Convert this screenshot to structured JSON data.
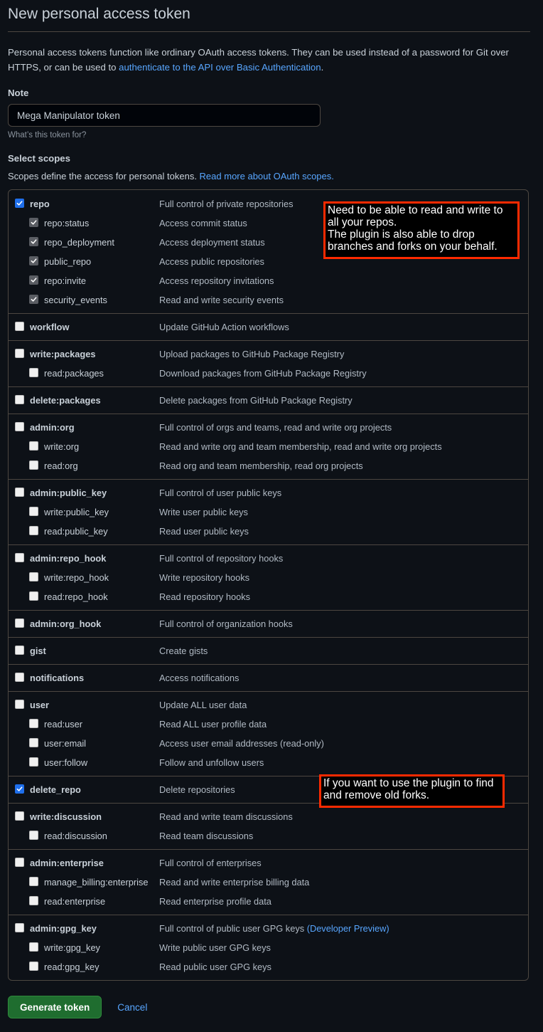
{
  "page": {
    "title": "New personal access token",
    "intro_text": "Personal access tokens function like ordinary OAuth access tokens. They can be used instead of a password for Git over HTTPS, or can be used to ",
    "intro_link": "authenticate to the API over Basic Authentication",
    "intro_suffix": "."
  },
  "note": {
    "label": "Note",
    "value": "Mega Manipulator token",
    "hint": "What’s this token for?"
  },
  "scopes": {
    "title": "Select scopes",
    "description": "Scopes define the access for personal tokens. ",
    "link": "Read more about OAuth scopes.",
    "groups": [
      {
        "name": "repo",
        "description": "Full control of private repositories",
        "checked": true,
        "children": [
          {
            "name": "repo:status",
            "description": "Access commit status",
            "checked": true
          },
          {
            "name": "repo_deployment",
            "description": "Access deployment status",
            "checked": true
          },
          {
            "name": "public_repo",
            "description": "Access public repositories",
            "checked": true
          },
          {
            "name": "repo:invite",
            "description": "Access repository invitations",
            "checked": true
          },
          {
            "name": "security_events",
            "description": "Read and write security events",
            "checked": true
          }
        ]
      },
      {
        "name": "workflow",
        "description": "Update GitHub Action workflows",
        "checked": false,
        "children": []
      },
      {
        "name": "write:packages",
        "description": "Upload packages to GitHub Package Registry",
        "checked": false,
        "children": [
          {
            "name": "read:packages",
            "description": "Download packages from GitHub Package Registry",
            "checked": false
          }
        ]
      },
      {
        "name": "delete:packages",
        "description": "Delete packages from GitHub Package Registry",
        "checked": false,
        "children": []
      },
      {
        "name": "admin:org",
        "description": "Full control of orgs and teams, read and write org projects",
        "checked": false,
        "children": [
          {
            "name": "write:org",
            "description": "Read and write org and team membership, read and write org projects",
            "checked": false
          },
          {
            "name": "read:org",
            "description": "Read org and team membership, read org projects",
            "checked": false
          }
        ]
      },
      {
        "name": "admin:public_key",
        "description": "Full control of user public keys",
        "checked": false,
        "children": [
          {
            "name": "write:public_key",
            "description": "Write user public keys",
            "checked": false
          },
          {
            "name": "read:public_key",
            "description": "Read user public keys",
            "checked": false
          }
        ]
      },
      {
        "name": "admin:repo_hook",
        "description": "Full control of repository hooks",
        "checked": false,
        "children": [
          {
            "name": "write:repo_hook",
            "description": "Write repository hooks",
            "checked": false
          },
          {
            "name": "read:repo_hook",
            "description": "Read repository hooks",
            "checked": false
          }
        ]
      },
      {
        "name": "admin:org_hook",
        "description": "Full control of organization hooks",
        "checked": false,
        "children": []
      },
      {
        "name": "gist",
        "description": "Create gists",
        "checked": false,
        "children": []
      },
      {
        "name": "notifications",
        "description": "Access notifications",
        "checked": false,
        "children": []
      },
      {
        "name": "user",
        "description": "Update ALL user data",
        "checked": false,
        "children": [
          {
            "name": "read:user",
            "description": "Read ALL user profile data",
            "checked": false
          },
          {
            "name": "user:email",
            "description": "Access user email addresses (read-only)",
            "checked": false
          },
          {
            "name": "user:follow",
            "description": "Follow and unfollow users",
            "checked": false
          }
        ]
      },
      {
        "name": "delete_repo",
        "description": "Delete repositories",
        "checked": true,
        "children": []
      },
      {
        "name": "write:discussion",
        "description": "Read and write team discussions",
        "checked": false,
        "children": [
          {
            "name": "read:discussion",
            "description": "Read team discussions",
            "checked": false
          }
        ]
      },
      {
        "name": "admin:enterprise",
        "description": "Full control of enterprises",
        "checked": false,
        "children": [
          {
            "name": "manage_billing:enterprise",
            "description": "Read and write enterprise billing data",
            "checked": false
          },
          {
            "name": "read:enterprise",
            "description": "Read enterprise profile data",
            "checked": false
          }
        ]
      },
      {
        "name": "admin:gpg_key",
        "description": "Full control of public user GPG keys",
        "description_link": "(Developer Preview)",
        "checked": false,
        "children": [
          {
            "name": "write:gpg_key",
            "description": "Write public user GPG keys",
            "checked": false
          },
          {
            "name": "read:gpg_key",
            "description": "Read public user GPG keys",
            "checked": false
          }
        ]
      }
    ]
  },
  "annotations": {
    "repo_note": [
      "Need to be able to read and write to",
      "all your repos.",
      "The plugin is also able to drop",
      "branches and forks on your behalf."
    ],
    "delete_repo_note": [
      "If you want to use the plugin to find",
      "and remove old forks."
    ]
  },
  "actions": {
    "generate_label": "Generate token",
    "cancel_label": "Cancel"
  },
  "colors": {
    "background": "#0d1117",
    "accent_link": "#58a6ff",
    "checkbox_checked": "#1f6feb",
    "generate_button": "#238636",
    "annotation_border": "#ff2a00"
  }
}
